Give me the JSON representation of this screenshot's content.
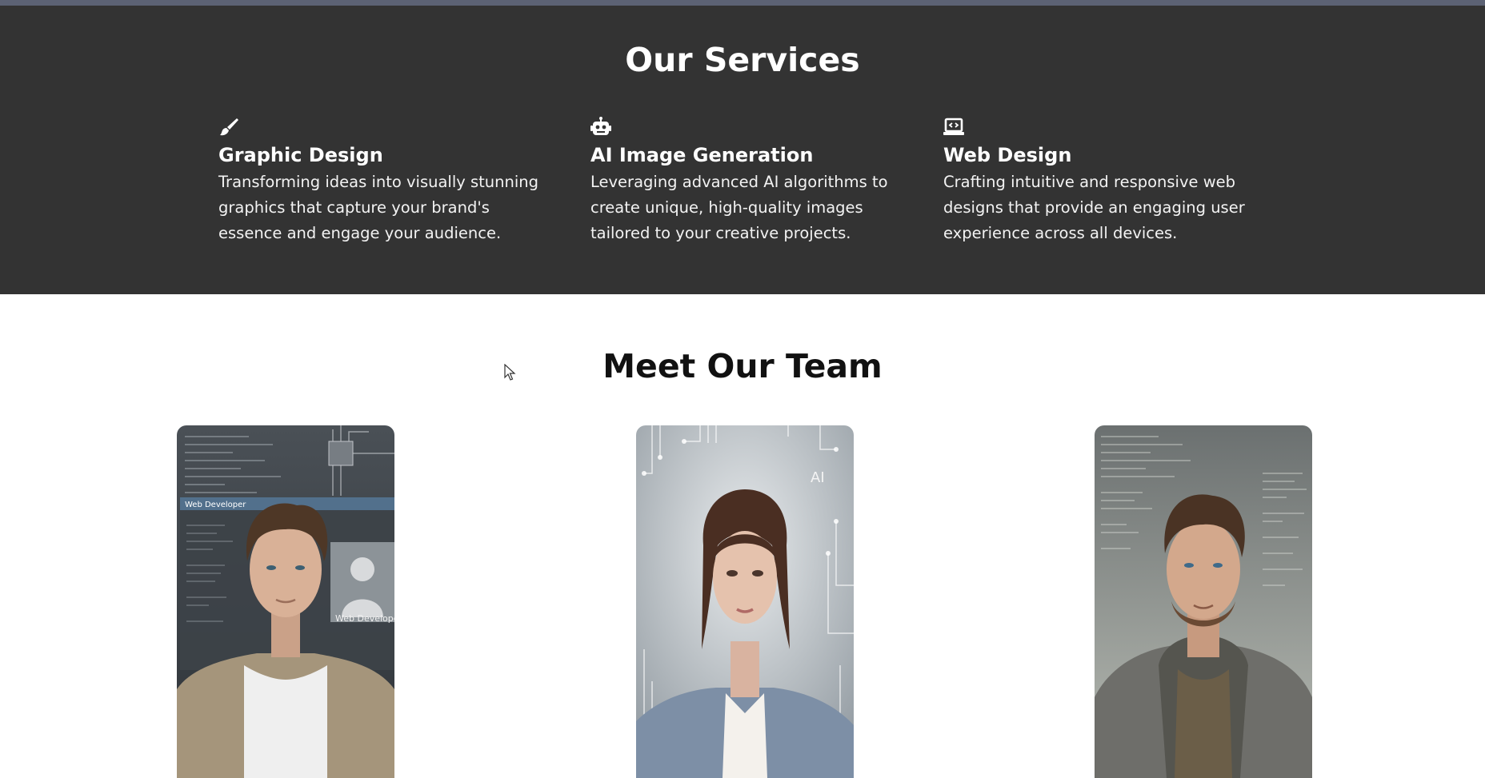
{
  "services_section": {
    "title": "Our Services",
    "items": [
      {
        "icon": "paintbrush-icon",
        "name": "Graphic Design",
        "description": "Transforming ideas into visually stunning graphics that capture your brand's essence and engage your audience."
      },
      {
        "icon": "robot-icon",
        "name": "AI Image Generation",
        "description": "Leveraging advanced AI algorithms to create unique, high-quality images tailored to your creative projects."
      },
      {
        "icon": "laptop-code-icon",
        "name": "Web Design",
        "description": "Crafting intuitive and responsive web designs that provide an engaging user experience across all devices."
      }
    ]
  },
  "team_section": {
    "title": "Meet Our Team",
    "members": [
      {
        "photo": "web-developer-portrait",
        "photo_caption": "Web Develope",
        "window_title": "Web Developer"
      },
      {
        "photo": "ai-specialist-portrait",
        "photo_caption": "AI"
      },
      {
        "photo": "developer-portrait-coding-background"
      }
    ]
  },
  "colors": {
    "services_bg": "#333333",
    "top_bar": "#5c6274",
    "page_bg": "#ffffff"
  }
}
